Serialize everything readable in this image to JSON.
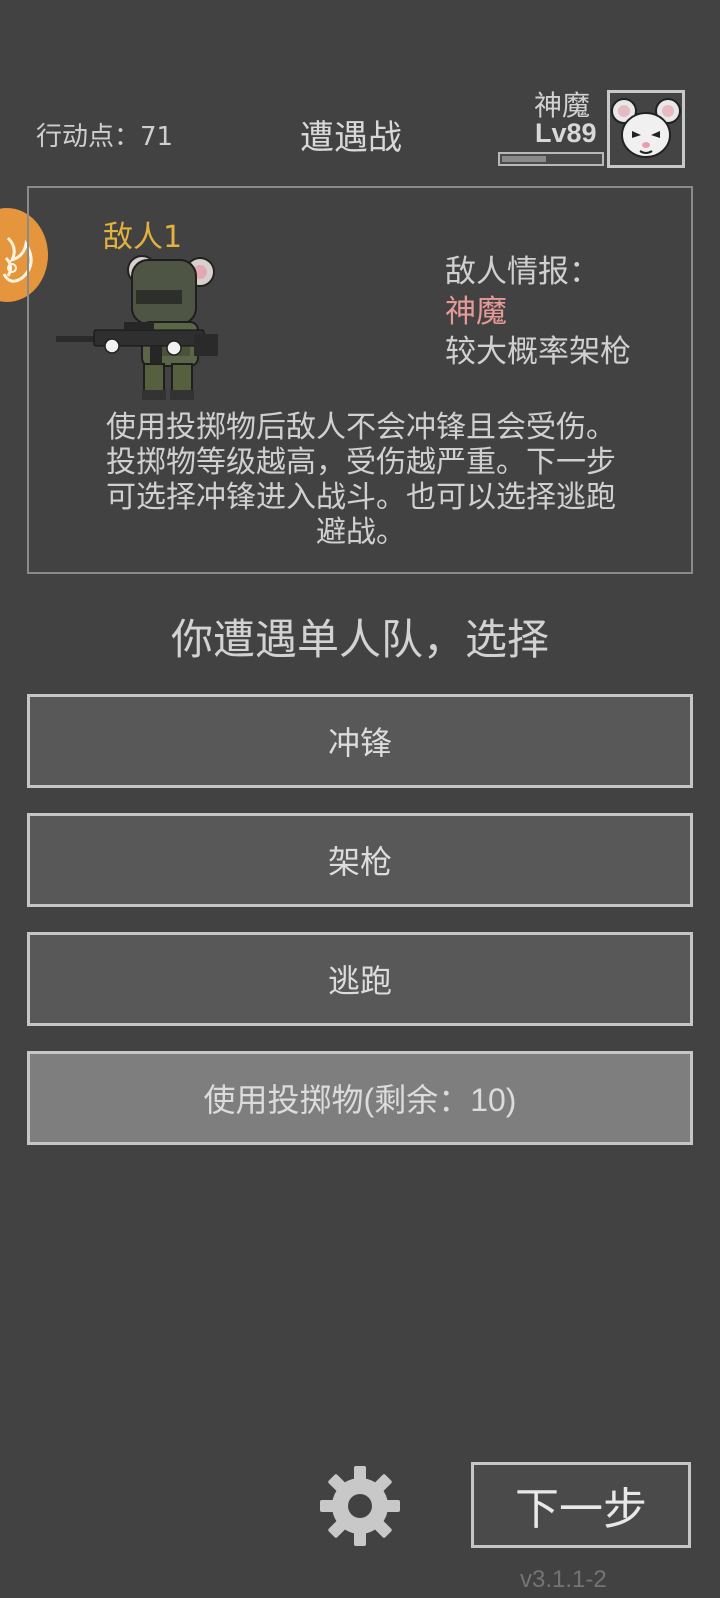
{
  "header": {
    "action_points_label": "行动点：",
    "action_points_value": "71",
    "title": "遭遇战",
    "player_name": "神魔",
    "player_level": "Lv89",
    "xp_progress": 0.45,
    "avatar_icon": "white-mouse-avatar-icon"
  },
  "side_tab": {
    "icon": "flame-icon",
    "color": "#e5953b"
  },
  "enemy_panel": {
    "enemy_name": "敌人1",
    "enemy_sprite_icon": "armored-mouse-soldier-with-rifle-icon",
    "intel_header": "敌人情报：",
    "intel_name": "神魔",
    "intel_behavior": "较大概率架枪",
    "description_lines": [
      "使用投掷物后敌人不会冲锋且会受伤。",
      "投掷物等级越高，受伤越严重。下一步",
      "可选择冲锋进入战斗。也可以选择逃跑",
      "避战。"
    ]
  },
  "prompt": "你遭遇单人队，选择",
  "actions": {
    "charge": "冲锋",
    "suppress": "架枪",
    "flee": "逃跑",
    "throwable": "使用投掷物(剩余：10)"
  },
  "footer": {
    "settings_icon": "gear-icon",
    "next_label": "下一步",
    "version": "v3.1.1-2"
  },
  "colors": {
    "background": "#424242",
    "enemy_name": "#e3b13e",
    "intel_name": "#e69a97",
    "button_border": "#c6c6c6"
  }
}
